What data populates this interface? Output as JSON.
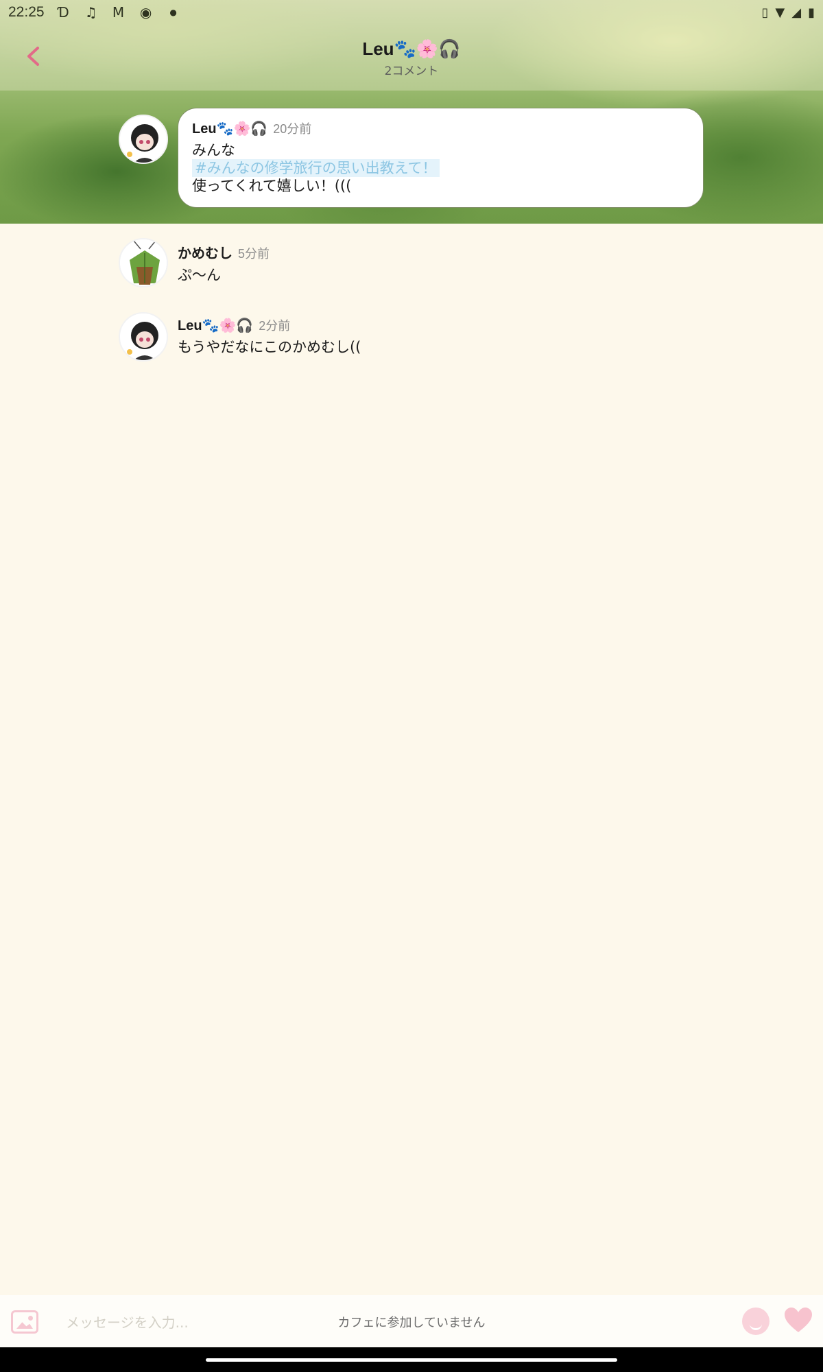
{
  "status_bar": {
    "time": "22:25",
    "left_icons": [
      "disney-plus-icon",
      "music-note-icon",
      "gmail-icon",
      "screen-record-icon",
      "dot-icon"
    ],
    "right_icons": [
      "vibrate-icon",
      "wifi-icon",
      "signal-icon",
      "battery-icon"
    ]
  },
  "header": {
    "title": "Leu🐾🌸🎧",
    "subtitle": "2コメント"
  },
  "original_post": {
    "user_name": "Leu🐾🌸🎧",
    "time": "20分前",
    "line1": "みんな",
    "hashtag": "#みんなの修学旅行の思い出教えて！",
    "line3": "使ってくれて嬉しい！((("
  },
  "comments": [
    {
      "user_name": "かめむし",
      "time": "5分前",
      "text": "ぷ〜ん"
    },
    {
      "user_name": "Leu🐾🌸🎧",
      "time": "2分前",
      "text": "もうやだなにこのかめむし(("
    }
  ],
  "input_bar": {
    "placeholder": "メッセージを入力...",
    "notice": "カフェに参加していません"
  },
  "colors": {
    "background": "#fdf8eb",
    "accent_pink": "#e26a88",
    "hashtag_blue": "#8dc6e3"
  }
}
